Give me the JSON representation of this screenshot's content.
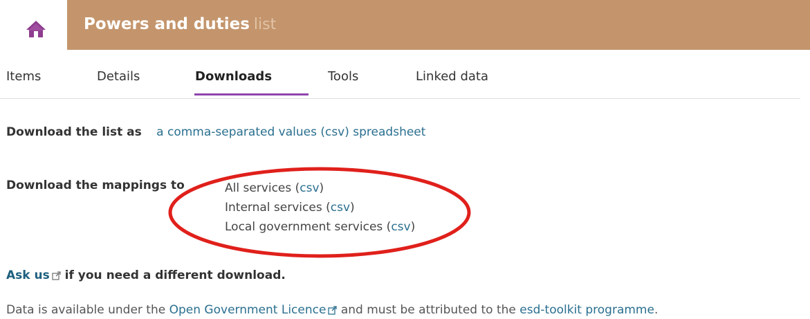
{
  "header": {
    "title": "Powers and duties",
    "subtitle": "list",
    "home_icon": "home-icon",
    "accent_color": "#c4956c",
    "home_color": "#8e3d8f"
  },
  "tabs": [
    {
      "label": "Items",
      "active": false
    },
    {
      "label": "Details",
      "active": false
    },
    {
      "label": "Downloads",
      "active": true
    },
    {
      "label": "Tools",
      "active": false
    },
    {
      "label": "Linked data",
      "active": false
    }
  ],
  "download_list": {
    "label": "Download the list as",
    "link": "a comma-separated values (csv) spreadsheet"
  },
  "download_mappings": {
    "label": "Download the mappings to",
    "items": [
      {
        "text": "All services",
        "link": "csv"
      },
      {
        "text": "Internal services",
        "link": "csv"
      },
      {
        "text": "Local government services",
        "link": "csv"
      }
    ]
  },
  "ask": {
    "link": "Ask us",
    "text": "if you need a different download."
  },
  "licence": {
    "prefix": "Data is available under the",
    "link1": "Open Government Licence",
    "middle": "and must be attributed to the",
    "link2": "esd-toolkit programme",
    "suffix": "."
  },
  "annotation_color": "#e0201b"
}
